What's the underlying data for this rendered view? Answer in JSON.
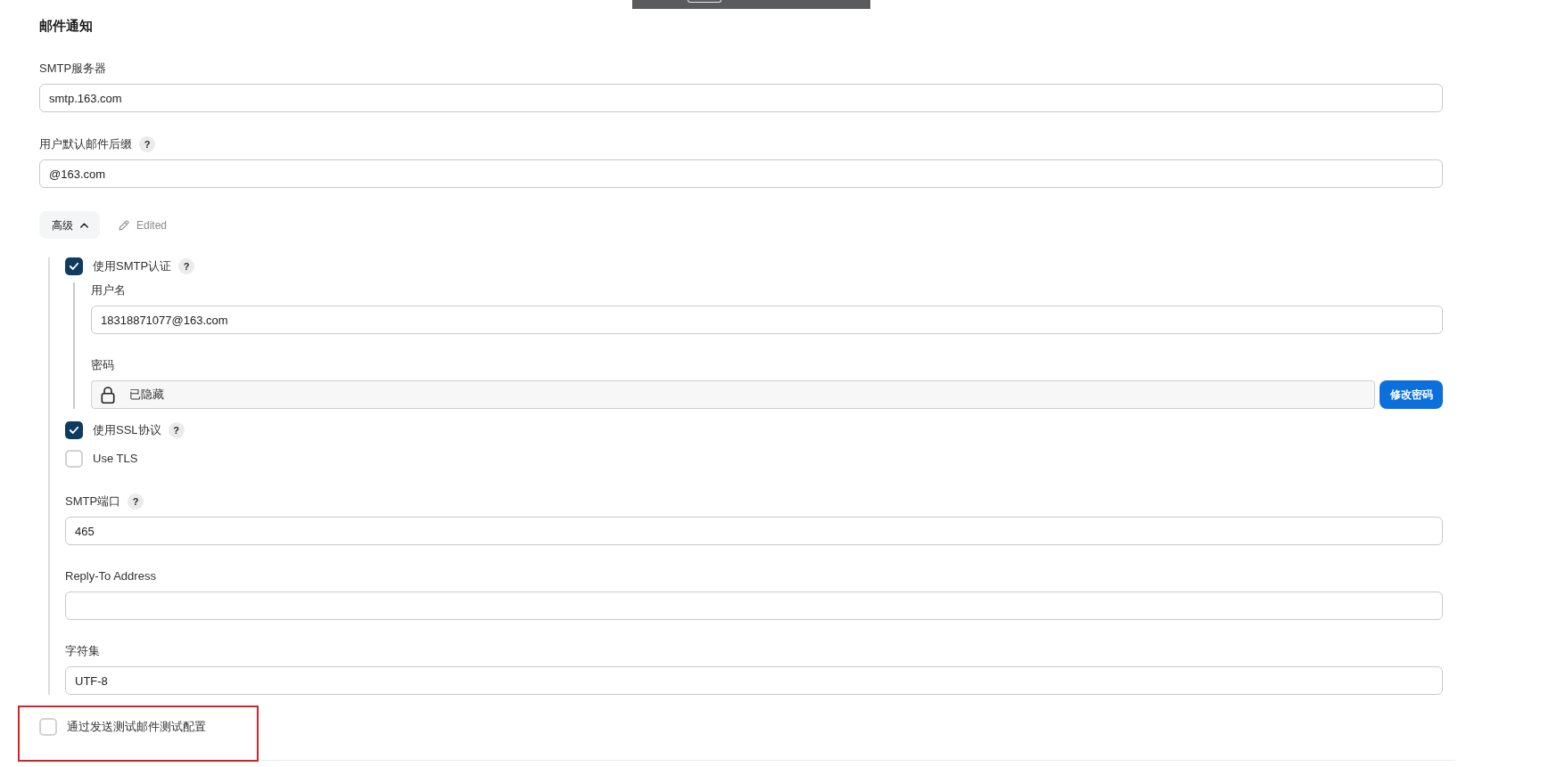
{
  "section": {
    "title": "邮件通知"
  },
  "fields": [
    {
      "label": "SMTP服务器",
      "value": "smtp.163.com"
    },
    {
      "label": "用户默认邮件后缀",
      "help": "?",
      "value": "@163.com"
    }
  ],
  "advanced": {
    "label": "高级",
    "expanded": true,
    "note": "Edited",
    "items": [
      {
        "kind": "checkbox",
        "label": "使用SMTP认证",
        "help": "?",
        "checked": true,
        "fields": [
          {
            "kind": "text",
            "label": "用户名",
            "value": "18318871077@163.com"
          },
          {
            "kind": "secret",
            "label": "密码",
            "value": "已隐藏",
            "button": "修改密码"
          }
        ]
      },
      {
        "kind": "checkbox",
        "label": "使用SSL协议",
        "help": "?",
        "checked": true
      },
      {
        "kind": "checkbox",
        "label": "Use TLS",
        "checked": false
      },
      {
        "kind": "text",
        "label": "SMTP端口",
        "help": "?",
        "value": "465"
      },
      {
        "kind": "text",
        "label": "Reply-To Address"
      },
      {
        "kind": "text",
        "label": "字符集",
        "value": "UTF-8"
      }
    ]
  },
  "test_mail": {
    "label": "通过发送测试邮件测试配置",
    "checked": false,
    "highlighted": true
  }
}
